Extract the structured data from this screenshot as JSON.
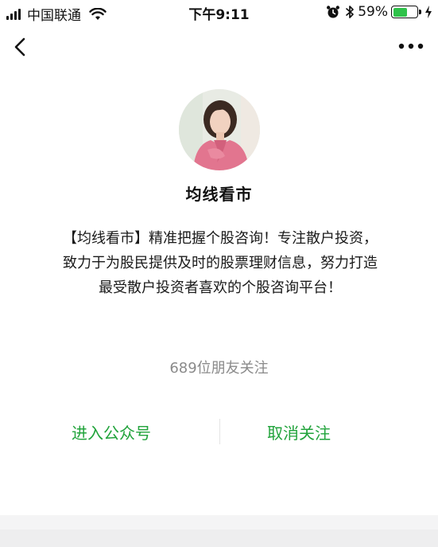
{
  "status_bar": {
    "carrier": "中国联通",
    "time": "下午9:11",
    "battery_percent": "59%",
    "battery_level": 0.59,
    "icons": [
      "signal-icon",
      "wifi-icon",
      "alarm-icon",
      "bluetooth-icon",
      "battery-icon",
      "charging-icon"
    ]
  },
  "nav": {
    "back_icon": "chevron-left-icon",
    "more_icon": "more-dots-icon"
  },
  "profile": {
    "name": "均线看市",
    "intro": "【均线看市】精准把握个股咨询！专注散户投资，致力于为股民提供及时的股票理财信息，努力打造最受散户投资者喜欢的个股咨询平台！",
    "followers": "689位朋友关注"
  },
  "actions": {
    "enter_label": "进入公众号",
    "unfollow_label": "取消关注",
    "accent_color": "#21a33b"
  }
}
